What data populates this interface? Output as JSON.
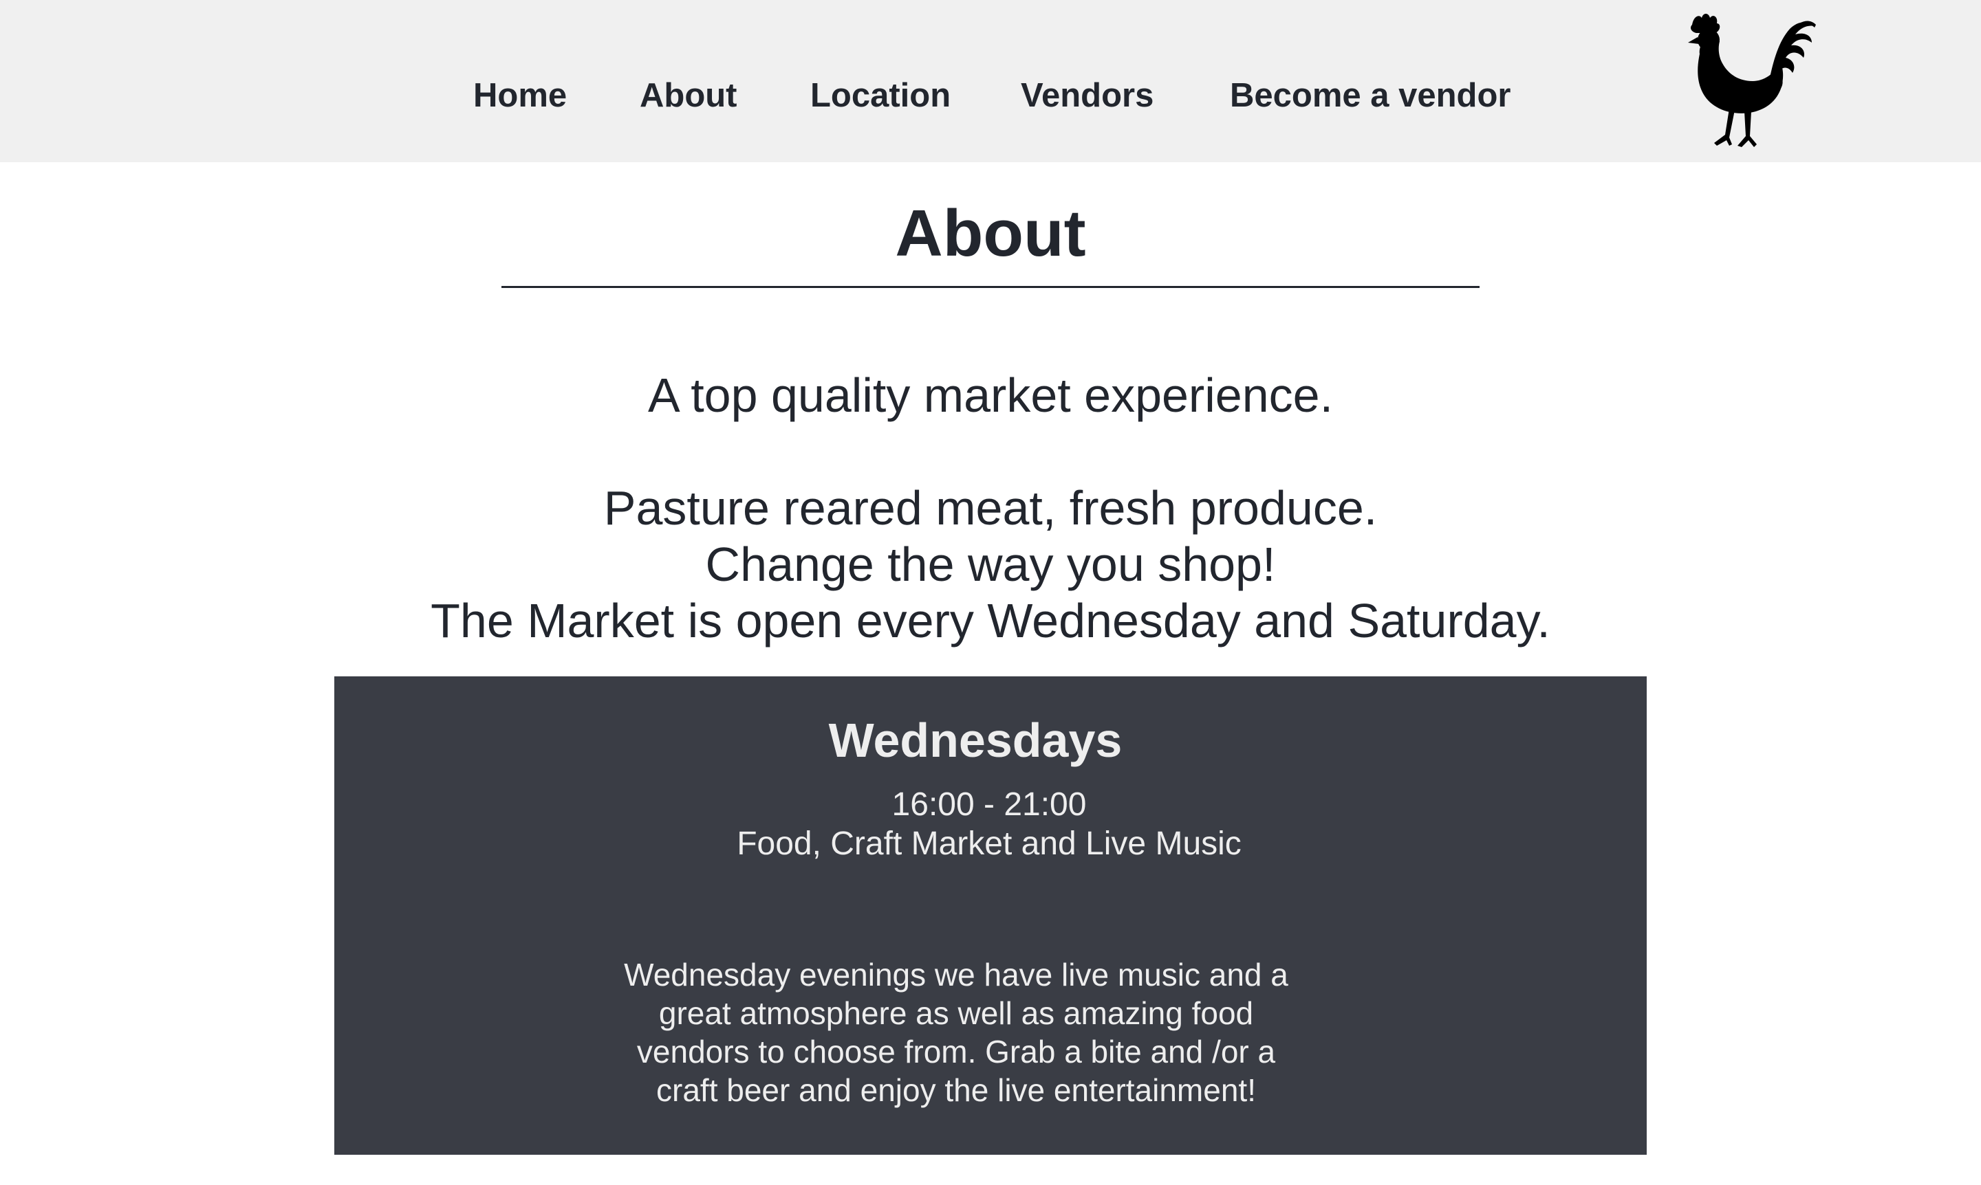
{
  "nav": {
    "items": [
      {
        "label": "Home"
      },
      {
        "label": "About"
      },
      {
        "label": "Location"
      },
      {
        "label": "Vendors"
      },
      {
        "label": "Become a vendor"
      }
    ],
    "logo_icon": "rooster-icon"
  },
  "about": {
    "title": "About",
    "tagline": "A top quality market experience.",
    "lines": [
      "Pasture reared meat, fresh produce.",
      "Change the way you shop!",
      "The Market is open every Wednesday and Saturday."
    ]
  },
  "schedule": {
    "day": "Wednesdays",
    "hours": "16:00 - 21:00",
    "features": "Food, Craft Market and Live Music",
    "description": "Wednesday evenings we have live music and a great atmosphere as well as amazing food vendors to choose from. Grab a bite and /or a craft beer and enjoy the live entertainment!"
  },
  "colors": {
    "nav_background": "#f0f0f0",
    "text": "#22262e",
    "card_background": "#3a3d45",
    "card_text": "#eeeeee"
  }
}
